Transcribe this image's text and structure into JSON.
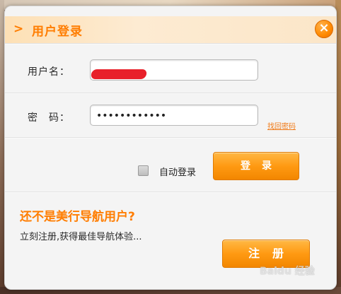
{
  "dialog": {
    "title": "用户登录",
    "close_glyph": "×"
  },
  "form": {
    "username_label": "用户名：",
    "password_label": "密　码：",
    "password_value": "••••••••••••",
    "forgot_link": "找回密码",
    "remember_label": "自动登录",
    "remember_checked": false,
    "login_button": "登录"
  },
  "promo": {
    "title": "还不是美行导航用户?",
    "subtitle": "立刻注册,获得最佳导航体验...",
    "register_button": "注册"
  },
  "watermark": "Baidu 经验",
  "colors": {
    "accent": "#ff7d00",
    "header_bg": "#fde0b5",
    "button_orange": "#ff9a12",
    "redaction": "#e8202a"
  },
  "icons": {
    "header": "chevron-right-icon",
    "close": "close-icon"
  }
}
